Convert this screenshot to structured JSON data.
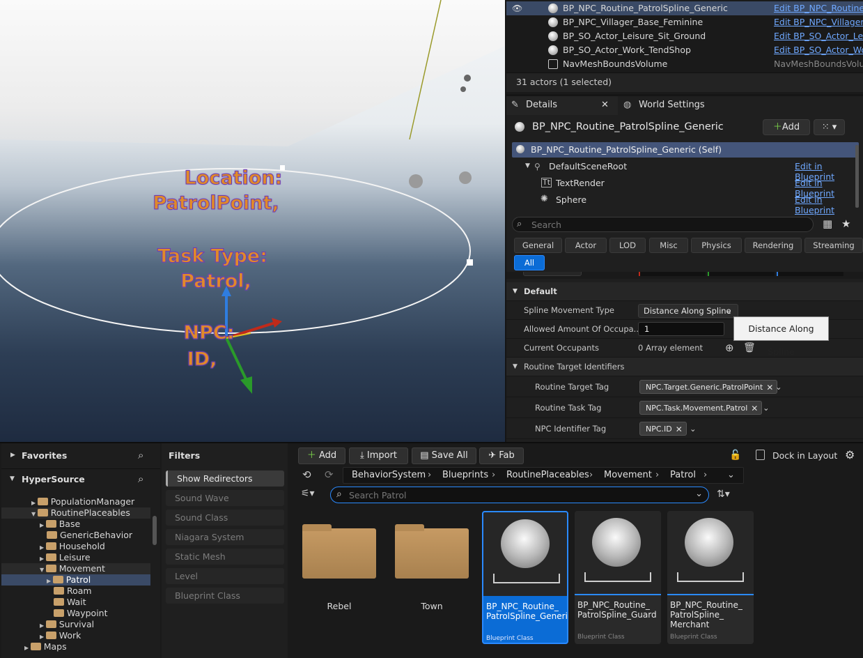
{
  "viewport": {
    "line1": "Location:",
    "line2": "PatrolPoint,",
    "line3": "Task Type:",
    "line4": "Patrol,",
    "line5": "NPC:",
    "line6": "ID,"
  },
  "outliner": {
    "rows": [
      {
        "name": "BP_NPC_Routine_PatrolSpline_Generic",
        "edit": "Edit BP_NPC_Routine_"
      },
      {
        "name": "BP_NPC_Villager_Base_Feminine",
        "edit": "Edit BP_NPC_Villager_B"
      },
      {
        "name": "BP_SO_Actor_Leisure_Sit_Ground",
        "edit": "Edit BP_SO_Actor_Leis"
      },
      {
        "name": "BP_SO_Actor_Work_TendShop",
        "edit": "Edit BP_SO_Actor_Wor"
      },
      {
        "name": "NavMeshBoundsVolume",
        "edit": "NavMeshBoundsVolum"
      }
    ],
    "status": "31 actors (1 selected)"
  },
  "details": {
    "tab_details": "Details",
    "tab_world": "World Settings",
    "actor_name": "BP_NPC_Routine_PatrolSpline_Generic",
    "add_label": "Add",
    "components": [
      {
        "name": "BP_NPC_Routine_PatrolSpline_Generic (Self)",
        "edit": ""
      },
      {
        "name": "DefaultSceneRoot",
        "edit": "Edit in Blueprint"
      },
      {
        "name": "TextRender",
        "edit": "Edit in Blueprint"
      },
      {
        "name": "Sphere",
        "edit": "Edit in Blueprint"
      }
    ],
    "search_placeholder": "Search",
    "filters": [
      "General",
      "Actor",
      "LOD",
      "Misc",
      "Physics",
      "Rendering",
      "Streaming",
      "All"
    ],
    "section_default": "Default",
    "props": {
      "spline_label": "Spline Movement Type",
      "spline_value": "Distance Along Spline",
      "allowed_label": "Allowed Amount Of Occupa...",
      "allowed_value": "1",
      "occupants_label": "Current Occupants",
      "occupants_value": "0 Array element",
      "tooltip": "Distance Along Spline"
    },
    "section_routine": "Routine Target Identifiers",
    "tags": {
      "target_label": "Routine Target Tag",
      "target_value": "NPC.Target.Generic.PatrolPoint",
      "task_label": "Routine Task Tag",
      "task_value": "NPC.Task.Movement.Patrol",
      "npc_label": "NPC Identifier Tag",
      "npc_value": "NPC.ID"
    }
  },
  "content_browser": {
    "favorites": "Favorites",
    "root": "HyperSource",
    "tree": [
      {
        "label": "PopulationManager"
      },
      {
        "label": "RoutinePlaceables"
      },
      {
        "label": "Base"
      },
      {
        "label": "GenericBehavior"
      },
      {
        "label": "Household"
      },
      {
        "label": "Leisure"
      },
      {
        "label": "Movement"
      },
      {
        "label": "Patrol"
      },
      {
        "label": "Roam"
      },
      {
        "label": "Wait"
      },
      {
        "label": "Waypoint"
      },
      {
        "label": "Survival"
      },
      {
        "label": "Work"
      },
      {
        "label": "Maps"
      }
    ],
    "filters_title": "Filters",
    "filter_items": [
      "Show Redirectors",
      "Sound Wave",
      "Sound Class",
      "Niagara System",
      "Static Mesh",
      "Level",
      "Blueprint Class"
    ],
    "toolbar": {
      "add": "Add",
      "import": "Import",
      "save_all": "Save All",
      "fab": "Fab",
      "dock": "Dock in Layout"
    },
    "breadcrumbs": [
      "BehaviorSystem",
      "Blueprints",
      "RoutinePlaceables",
      "Movement",
      "Patrol"
    ],
    "search_placeholder": "Search Patrol",
    "folders": [
      "Rebel",
      "Town"
    ],
    "assets": [
      {
        "name": "BP_NPC_Routine_ PatrolSpline_Generic",
        "cls": "Blueprint Class"
      },
      {
        "name": "BP_NPC_Routine_ PatrolSpline_Guard",
        "cls": "Blueprint Class"
      },
      {
        "name": "BP_NPC_Routine_ PatrolSpline_ Merchant",
        "cls": "Blueprint Class"
      }
    ]
  }
}
